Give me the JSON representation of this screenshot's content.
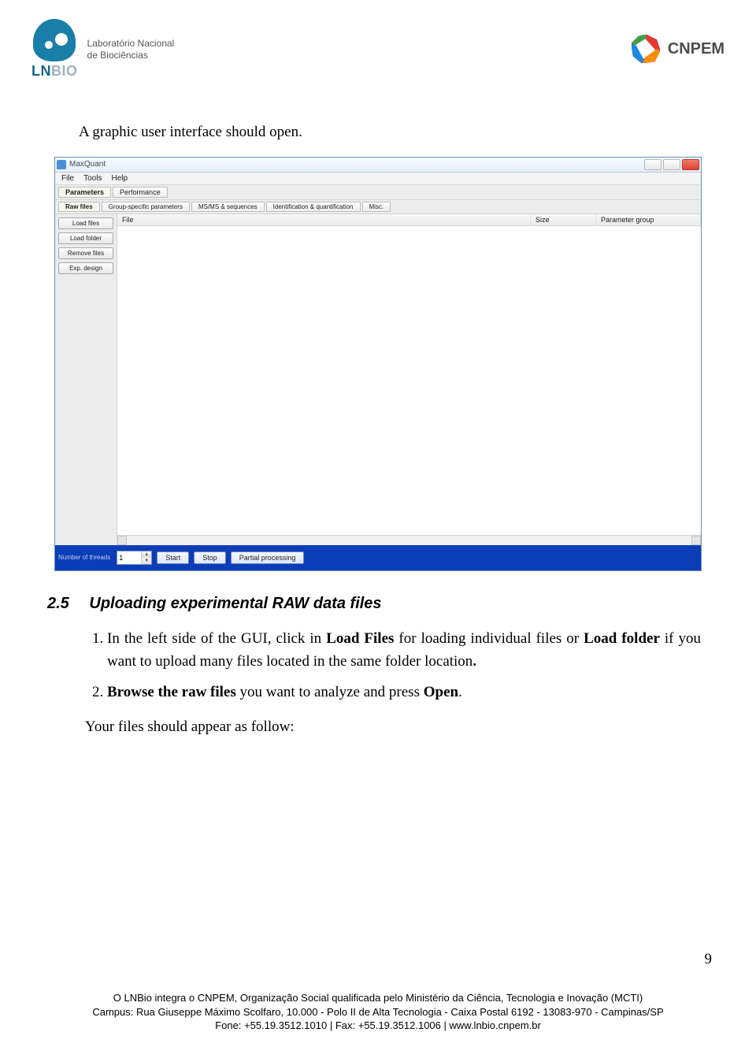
{
  "header": {
    "lnbio_word_prefix": "LN",
    "lnbio_word_suffix": "BIO",
    "lnbio_label_line1": "Laboratório Nacional",
    "lnbio_label_line2": "de Biociências",
    "cnpem_word": "CNPEM"
  },
  "text": {
    "intro": "A graphic user interface should open.",
    "section_number": "2.5",
    "section_title": "Uploading experimental RAW data files",
    "step1_pre": "In the left side of the GUI, click in ",
    "step1_b1": "Load Files",
    "step1_mid": " for loading individual files or ",
    "step1_b2": "Load folder",
    "step1_post": " if you want to upload many files located in the same folder location",
    "step1_dot": ".",
    "step2_b1": "Browse the raw files",
    "step2_mid": " you want to analyze and press ",
    "step2_b2": "Open",
    "step2_post": ".",
    "follow": "Your files should appear as follow:"
  },
  "screenshot": {
    "title": "MaxQuant",
    "menus": [
      "File",
      "Tools",
      "Help"
    ],
    "tier1": [
      "Parameters",
      "Performance"
    ],
    "tier2": [
      "Raw files",
      "Group-specific parameters",
      "MS/MS & sequences",
      "Identification & quantification",
      "Misc."
    ],
    "left_buttons": [
      "Load files",
      "Load folder",
      "Remove files",
      "Exp. design"
    ],
    "columns": [
      "File",
      "Size",
      "Parameter group"
    ],
    "threads_label": "Number of threads",
    "threads_value": "1",
    "bottom_buttons": [
      "Start",
      "Stop",
      "Partial processing"
    ]
  },
  "page_number": "9",
  "footer": {
    "line1": "O LNBio integra o CNPEM, Organização Social qualificada pelo Ministério da Ciência, Tecnologia e Inovação (MCTI)",
    "line2": "Campus: Rua Giuseppe Máximo Scolfaro, 10.000 - Polo II de Alta Tecnologia - Caixa Postal 6192 - 13083-970 - Campinas/SP",
    "line3": "Fone: +55.19.3512.1010 | Fax: +55.19.3512.1006 | www.lnbio.cnpem.br"
  }
}
